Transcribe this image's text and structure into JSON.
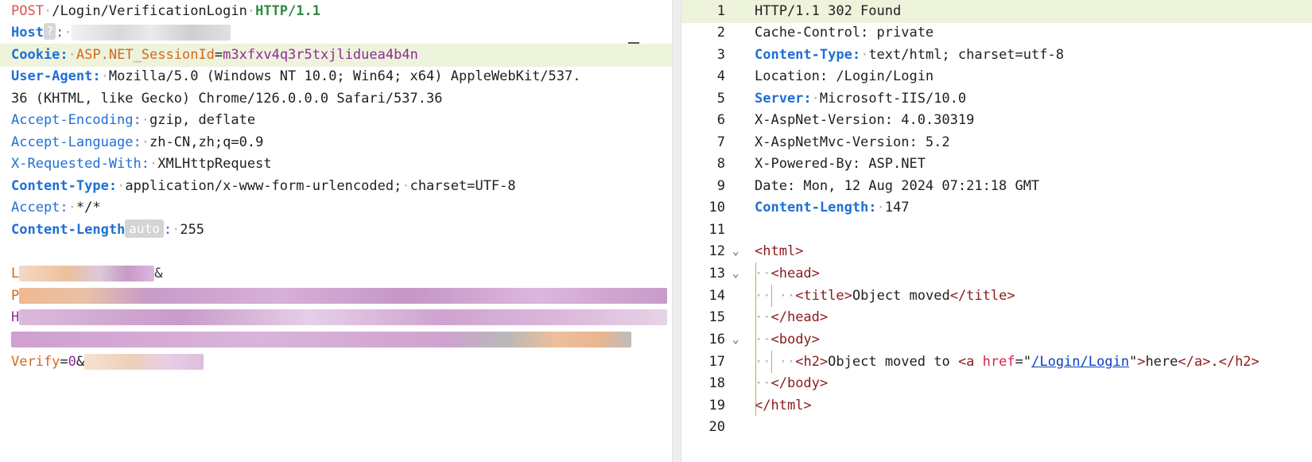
{
  "request": {
    "method": "POST",
    "path": "/Login/VerificationLogin",
    "protocol": "HTTP/1.1",
    "host_name": "Host",
    "host_chip": "?",
    "cookie_name": "Cookie",
    "cookie_key": "ASP.NET_SessionId",
    "cookie_value": "m3xfxv4q3r5txjliduea4b4n",
    "ua_name": "User-Agent",
    "ua_value_1": "Mozilla/5.0 (Windows NT 10.0; Win64; x64) AppleWebKit/537.",
    "ua_value_2": "36 (KHTML, like Gecko) Chrome/126.0.0.0 Safari/537.36",
    "ae_name": "Accept-Encoding",
    "ae_value": "gzip, deflate",
    "al_name": "Accept-Language",
    "al_value": "zh-CN,zh;q=0.9",
    "xrw_name": "X-Requested-With",
    "xrw_value": "XMLHttpRequest",
    "ct_name": "Content-Type",
    "ct_value": "application/x-www-form-urlencoded;",
    "ct_charset": "charset=UTF-8",
    "accept_name": "Accept",
    "accept_value": "*/*",
    "cl_name": "Content-Length",
    "cl_chip": "auto",
    "cl_value": "255",
    "body_l1_start": "L",
    "body_l2_start": "P",
    "body_l3_start": "H",
    "verify_key": "Verify",
    "verify_value": "0"
  },
  "response": {
    "lines": [
      {
        "n": "1"
      },
      {
        "n": "2"
      },
      {
        "n": "3"
      },
      {
        "n": "4"
      },
      {
        "n": "5"
      },
      {
        "n": "6"
      },
      {
        "n": "7"
      },
      {
        "n": "8"
      },
      {
        "n": "9"
      },
      {
        "n": "10"
      },
      {
        "n": "11"
      },
      {
        "n": "12"
      },
      {
        "n": "13"
      },
      {
        "n": "14"
      },
      {
        "n": "15"
      },
      {
        "n": "16"
      },
      {
        "n": "17"
      },
      {
        "n": "18"
      },
      {
        "n": "19"
      },
      {
        "n": "20"
      }
    ],
    "status_line": "HTTP/1.1 302 Found",
    "cache_control": "Cache-Control: private",
    "ct_name": "Content-Type:",
    "ct_value": "text/html; charset=utf-8",
    "location": "Location: /Login/Login",
    "server_name": "Server:",
    "server_value": "Microsoft-IIS/10.0",
    "aspnet_version": "X-AspNet-Version: 4.0.30319",
    "mvc_version": "X-AspNetMvc-Version: 5.2",
    "powered_by": "X-Powered-By: ASP.NET",
    "date": "Date: Mon, 12 Aug 2024 07:21:18 GMT",
    "cl_name": "Content-Length:",
    "cl_value": "147",
    "html_open": "<html>",
    "head_open": "<head>",
    "title_open": "<title>",
    "title_text": "Object moved",
    "title_close": "</title>",
    "head_close": "</head>",
    "body_open": "<body>",
    "h2_open": "<h2>",
    "h2_text": "Object moved to ",
    "a_open": "<a",
    "href_attr": "href",
    "href_value": "/Login/Login",
    "a_text": "here",
    "a_close": "</a>",
    "h2_tail": ".",
    "h2_close": "</h2>",
    "body_close": "</body>",
    "html_close": "</html>"
  }
}
